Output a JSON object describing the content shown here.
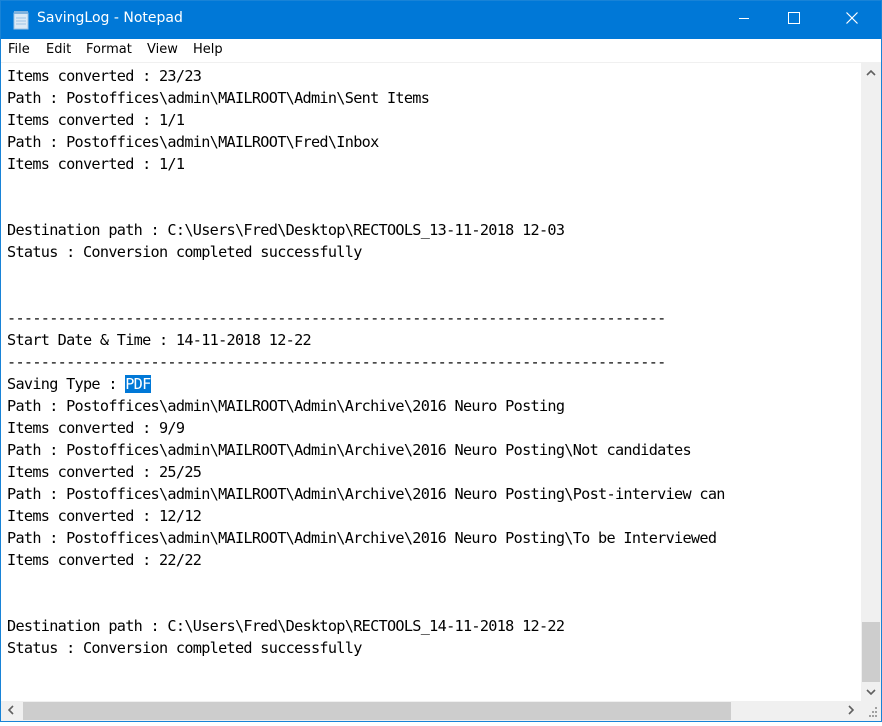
{
  "window": {
    "title": "SavingLog - Notepad",
    "app_icon": "notepad-icon",
    "controls": [
      "minimize-icon",
      "maximize-icon",
      "close-icon"
    ],
    "accent_color": "#0078d7"
  },
  "menu": {
    "items": [
      {
        "label": "File"
      },
      {
        "label": "Edit"
      },
      {
        "label": "Format"
      },
      {
        "label": "View"
      },
      {
        "label": "Help"
      }
    ]
  },
  "editor": {
    "lines": [
      "Items converted : 23/23",
      "Path : Postoffices\\admin\\MAILROOT\\Admin\\Sent Items",
      "Items converted : 1/1",
      "Path : Postoffices\\admin\\MAILROOT\\Fred\\Inbox",
      "Items converted : 1/1",
      "",
      "",
      "Destination path : C:\\Users\\Fred\\Desktop\\RECTOOLS_13-11-2018 12-03",
      "Status : Conversion completed successfully",
      "",
      "",
      "------------------------------------------------------------------------------",
      "Start Date & Time : 14-11-2018 12-22",
      "------------------------------------------------------------------------------",
      "Saving Type : ",
      "Path : Postoffices\\admin\\MAILROOT\\Admin\\Archive\\2016 Neuro Posting",
      "Items converted : 9/9",
      "Path : Postoffices\\admin\\MAILROOT\\Admin\\Archive\\2016 Neuro Posting\\Not candidates",
      "Items converted : 25/25",
      "Path : Postoffices\\admin\\MAILROOT\\Admin\\Archive\\2016 Neuro Posting\\Post-interview can",
      "Items converted : 12/12",
      "Path : Postoffices\\admin\\MAILROOT\\Admin\\Archive\\2016 Neuro Posting\\To be Interviewed",
      "Items converted : 22/22",
      "",
      "",
      "Destination path : C:\\Users\\Fred\\Desktop\\RECTOOLS_14-11-2018 12-22",
      "Status : Conversion completed successfully"
    ],
    "selected_text": "PDF",
    "selection_color": "#0078d7"
  },
  "scrollbars": {
    "vertical_position_fraction": 0.98,
    "horizontal_position_fraction": 0.0
  }
}
